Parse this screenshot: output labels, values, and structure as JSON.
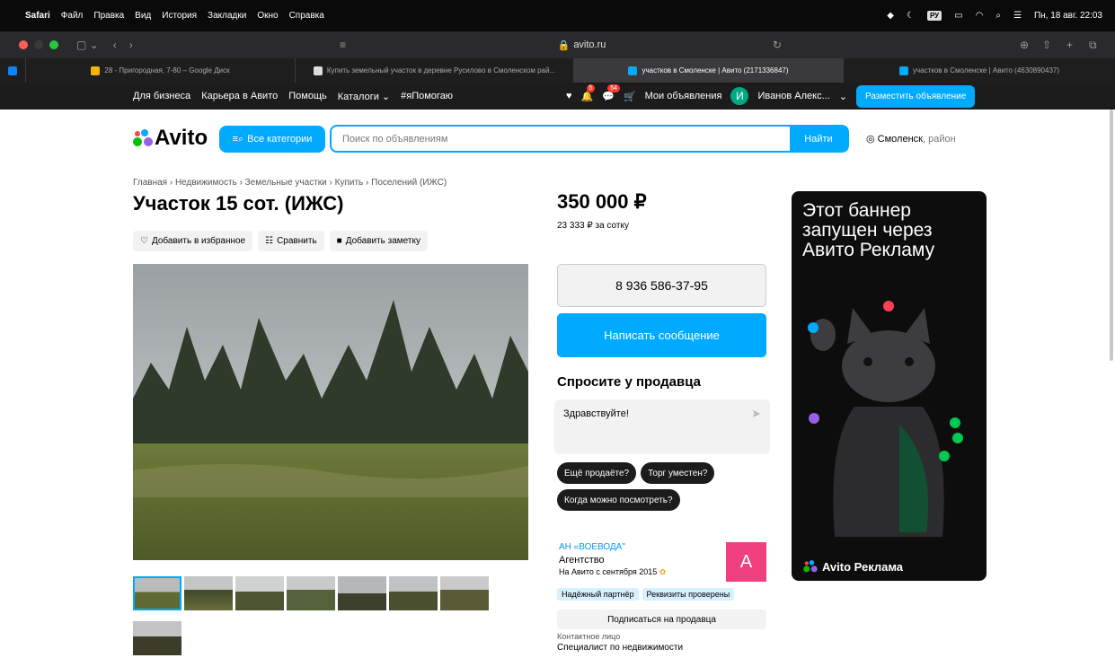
{
  "menubar": {
    "app": "Safari",
    "items": [
      "Файл",
      "Правка",
      "Вид",
      "История",
      "Закладки",
      "Окно",
      "Справка"
    ],
    "input_lang": "РУ",
    "clock": "Пн, 18 авг. 22:03"
  },
  "browser": {
    "url": "avito.ru",
    "tabs": [
      {
        "label": "28 - Пригородная, 7-80 – Google Диск",
        "active": false
      },
      {
        "label": "Купить земельный участок в деревне Русилово в Смоленском рай...",
        "active": false
      },
      {
        "label": "участков в Смоленске | Авито (2171336847)",
        "active": true
      },
      {
        "label": "участков в Смоленске | Авито (4630890437)",
        "active": false
      }
    ]
  },
  "topnav": {
    "left": [
      "Для бизнеса",
      "Карьера в Авито",
      "Помощь",
      "Каталоги ⌄",
      "#яПомогаю"
    ],
    "notif_count": "5",
    "msg_count": "54",
    "my_ads": "Мои объявления",
    "avatar_letter": "И",
    "user_name": "Иванов Алекс...",
    "post_ad": "Разместить объявление"
  },
  "header": {
    "logo": "Avito",
    "all_categories": "Все категории",
    "search_placeholder": "Поиск по объявлениям",
    "search_button": "Найти",
    "city": "Смоленск",
    "region": ", район"
  },
  "listing": {
    "breadcrumbs": "Главная › Недвижимость › Земельные участки › Купить › Поселений (ИЖС)",
    "title": "Участок 15 сот. (ИЖС)",
    "actions": [
      "Добавить в избранное",
      "Сравнить",
      "Добавить заметку"
    ],
    "price": "350 000 ₽",
    "price_per": "23 333 ₽ за сотку",
    "phone": "8 936 586-37-95",
    "write_message": "Написать сообщение",
    "ask_title": "Спросите у продавца",
    "ask_text": "Здравствуйте!",
    "quick_questions": [
      "Ещё продаёте?",
      "Торг уместен?",
      "Когда можно посмотреть?"
    ]
  },
  "seller": {
    "name": "АН «ВОЕВОДА\"",
    "type": "Агентство",
    "since": "На Авито с сентября 2015",
    "avatar_letter": "А",
    "tags": [
      "Надёжный партнёр",
      "Реквизиты проверены"
    ],
    "subscribe": "Подписаться на продавца",
    "contact_label": "Контактное лицо",
    "contact_value": "Специалист по недвижимости"
  },
  "banner": {
    "line1": "Этот баннер",
    "line2": "запущен через",
    "line3": "Авито Рекламу",
    "footer": "Avito Реклама"
  },
  "colors": {
    "accent": "#00aaff",
    "dark": "#1c1c1c",
    "seller_avatar": "#f0407f"
  }
}
